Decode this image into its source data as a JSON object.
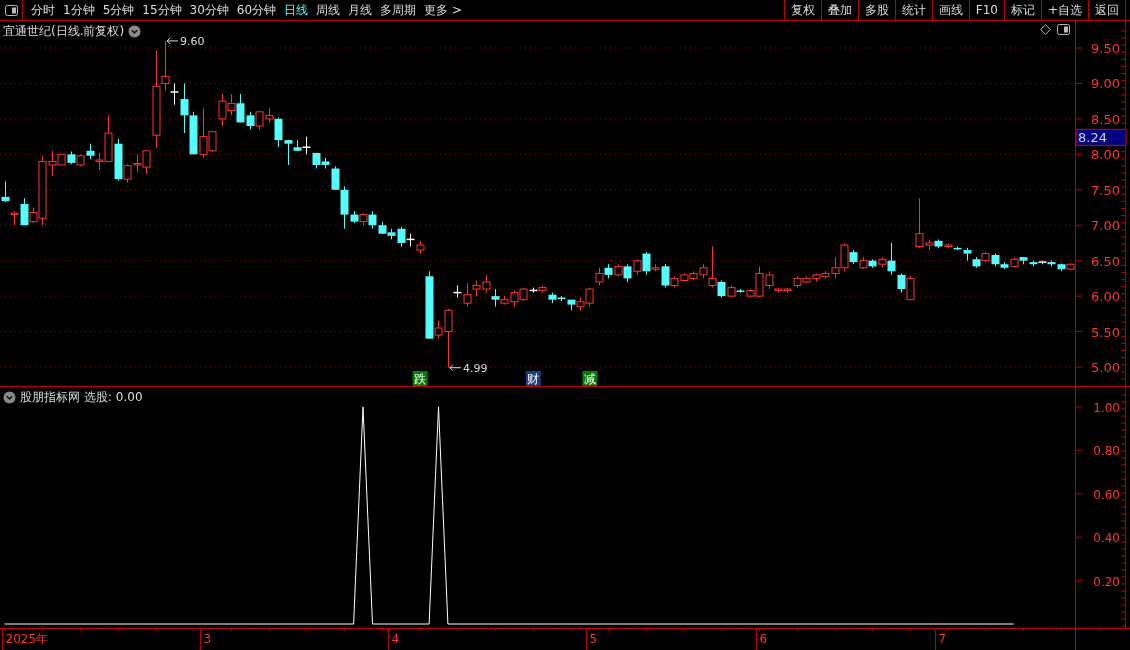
{
  "toolbar": {
    "periods": [
      {
        "label": "分时",
        "selected": false
      },
      {
        "label": "1分钟",
        "selected": false
      },
      {
        "label": "5分钟",
        "selected": false
      },
      {
        "label": "15分钟",
        "selected": false
      },
      {
        "label": "30分钟",
        "selected": false
      },
      {
        "label": "60分钟",
        "selected": false
      },
      {
        "label": "日线",
        "selected": true
      },
      {
        "label": "周线",
        "selected": false
      },
      {
        "label": "月线",
        "selected": false
      },
      {
        "label": "多周期",
        "selected": false
      },
      {
        "label": "更多 >",
        "selected": false
      }
    ],
    "actions": [
      "复权",
      "叠加",
      "多股",
      "统计",
      "画线",
      "F10",
      "标记",
      "+自选",
      "返回"
    ]
  },
  "price_panel": {
    "title": "宜通世纪(日线.前复权)",
    "cursor_price": "8.24",
    "chart_data": {
      "type": "candlestick",
      "ylim": [
        4.718,
        9.881
      ],
      "grid": true,
      "categories": [
        null,
        null,
        null,
        null,
        null,
        null,
        null,
        null,
        null,
        null,
        null,
        null,
        null,
        null,
        null,
        null,
        null,
        null,
        null,
        null,
        null,
        null,
        null,
        null,
        null,
        null,
        null,
        null,
        null,
        null,
        null,
        null,
        null,
        null,
        null,
        null,
        null,
        null,
        null,
        null,
        null,
        null,
        null,
        null,
        null,
        null,
        null,
        null,
        null,
        null,
        null,
        null,
        null,
        null,
        null,
        null,
        null,
        null,
        null,
        null,
        null,
        null,
        null,
        null,
        null,
        null,
        null,
        null,
        null,
        null,
        null,
        null,
        null,
        null,
        null,
        null,
        null,
        null,
        null,
        null,
        null,
        null,
        null,
        null,
        null,
        null,
        null,
        null,
        null,
        null,
        null,
        null,
        null,
        null,
        null,
        null,
        null,
        null,
        null,
        null,
        null,
        null,
        null,
        null,
        null,
        null,
        null,
        null,
        null,
        null,
        null,
        null,
        null,
        null
      ],
      "yticks": [
        {
          "value": 9.5,
          "label": "9.50"
        },
        {
          "value": 9,
          "label": "9.00"
        },
        {
          "value": 8.5,
          "label": "8.50"
        },
        {
          "value": 8,
          "label": "8.00"
        },
        {
          "value": 7.5,
          "label": "7.50"
        },
        {
          "value": 7,
          "label": "7.00"
        },
        {
          "value": 6.5,
          "label": "6.50"
        },
        {
          "value": 6,
          "label": "6.00"
        },
        {
          "value": 5.5,
          "label": "5.50"
        },
        {
          "value": 5,
          "label": "5.00"
        }
      ],
      "ohlc": [
        [
          7.4,
          7.62,
          7.33,
          7.34
        ],
        [
          7.15,
          7.2,
          7.0,
          7.17
        ],
        [
          7.3,
          7.38,
          7.0,
          7.0
        ],
        [
          7.05,
          7.25,
          7.03,
          7.18
        ],
        [
          7.1,
          7.98,
          7.0,
          7.9
        ],
        [
          7.85,
          8.05,
          7.7,
          7.9
        ],
        [
          7.85,
          8.0,
          7.85,
          8.0
        ],
        [
          8.0,
          8.04,
          7.86,
          7.88
        ],
        [
          7.85,
          8.0,
          7.83,
          7.98
        ],
        [
          8.05,
          8.15,
          7.93,
          7.98
        ],
        [
          7.9,
          8.02,
          7.78,
          7.92
        ],
        [
          7.9,
          8.55,
          7.9,
          8.3
        ],
        [
          8.15,
          8.22,
          7.63,
          7.65
        ],
        [
          7.65,
          7.86,
          7.6,
          7.84
        ],
        [
          7.85,
          8.0,
          7.75,
          7.87
        ],
        [
          7.82,
          8.05,
          7.72,
          8.05
        ],
        [
          8.27,
          9.46,
          8.09,
          8.96
        ],
        [
          9.0,
          9.6,
          8.9,
          9.1
        ],
        [
          8.88,
          9.0,
          8.7,
          8.88
        ],
        [
          8.78,
          9.0,
          8.3,
          8.55
        ],
        [
          8.55,
          8.6,
          8.0,
          8.0
        ],
        [
          8.0,
          8.65,
          7.95,
          8.25
        ],
        [
          8.05,
          8.33,
          8.03,
          8.32
        ],
        [
          8.5,
          8.85,
          8.4,
          8.75
        ],
        [
          8.62,
          8.85,
          8.55,
          8.72
        ],
        [
          8.72,
          8.85,
          8.45,
          8.45
        ],
        [
          8.55,
          8.6,
          8.35,
          8.4
        ],
        [
          8.4,
          8.6,
          8.35,
          8.6
        ],
        [
          8.5,
          8.65,
          8.45,
          8.55
        ],
        [
          8.5,
          8.52,
          8.1,
          8.2
        ],
        [
          8.2,
          8.2,
          7.85,
          8.15
        ],
        [
          8.1,
          8.2,
          8.05,
          8.05
        ],
        [
          8.1,
          8.25,
          8.0,
          8.1
        ],
        [
          8.02,
          8.02,
          7.8,
          7.85
        ],
        [
          7.9,
          7.95,
          7.8,
          7.85
        ],
        [
          7.8,
          7.83,
          7.5,
          7.5
        ],
        [
          7.5,
          7.55,
          6.95,
          7.15
        ],
        [
          7.15,
          7.2,
          7.03,
          7.05
        ],
        [
          7.05,
          7.17,
          7.0,
          7.15
        ],
        [
          7.15,
          7.2,
          6.95,
          7.0
        ],
        [
          7.0,
          7.05,
          6.88,
          6.88
        ],
        [
          6.9,
          6.95,
          6.8,
          6.85
        ],
        [
          6.95,
          6.98,
          6.7,
          6.75
        ],
        [
          6.8,
          6.88,
          6.7,
          6.8
        ],
        [
          6.65,
          6.78,
          6.6,
          6.72
        ],
        [
          6.28,
          6.35,
          5.4,
          5.4
        ],
        [
          5.45,
          5.65,
          5.4,
          5.55
        ],
        [
          5.5,
          5.82,
          4.99,
          5.8
        ],
        [
          6.05,
          6.15,
          5.98,
          6.05
        ],
        [
          5.9,
          6.18,
          5.85,
          6.02
        ],
        [
          6.1,
          6.22,
          6.0,
          6.15
        ],
        [
          6.1,
          6.3,
          6.05,
          6.2
        ],
        [
          6.0,
          6.1,
          5.85,
          5.95
        ],
        [
          5.9,
          6.0,
          5.88,
          5.95
        ],
        [
          5.92,
          6.08,
          5.85,
          6.05
        ],
        [
          5.95,
          6.12,
          5.93,
          6.1
        ],
        [
          6.08,
          6.12,
          6.05,
          6.08
        ],
        [
          6.08,
          6.15,
          6.05,
          6.12
        ],
        [
          6.02,
          6.05,
          5.9,
          5.95
        ],
        [
          5.98,
          6.0,
          5.93,
          5.97
        ],
        [
          5.95,
          5.95,
          5.8,
          5.88
        ],
        [
          5.85,
          5.98,
          5.8,
          5.92
        ],
        [
          5.9,
          6.12,
          5.85,
          6.1
        ],
        [
          6.2,
          6.4,
          6.15,
          6.32
        ],
        [
          6.4,
          6.45,
          6.25,
          6.3
        ],
        [
          6.3,
          6.45,
          6.28,
          6.42
        ],
        [
          6.42,
          6.45,
          6.2,
          6.25
        ],
        [
          6.35,
          6.52,
          6.3,
          6.5
        ],
        [
          6.6,
          6.62,
          6.3,
          6.35
        ],
        [
          6.38,
          6.45,
          6.35,
          6.4
        ],
        [
          6.42,
          6.45,
          6.12,
          6.15
        ],
        [
          6.15,
          6.28,
          6.12,
          6.25
        ],
        [
          6.22,
          6.32,
          6.2,
          6.3
        ],
        [
          6.25,
          6.35,
          6.22,
          6.32
        ],
        [
          6.3,
          6.45,
          6.25,
          6.4
        ],
        [
          6.15,
          6.7,
          6.12,
          6.25
        ],
        [
          6.2,
          6.22,
          5.98,
          6.0
        ],
        [
          6.0,
          6.15,
          5.98,
          6.12
        ],
        [
          6.08,
          6.1,
          6.05,
          6.07
        ],
        [
          6.0,
          6.1,
          5.98,
          6.08
        ],
        [
          6.0,
          6.42,
          5.98,
          6.32
        ],
        [
          6.15,
          6.35,
          6.1,
          6.3
        ],
        [
          6.08,
          6.12,
          6.05,
          6.1
        ],
        [
          6.08,
          6.12,
          6.05,
          6.1
        ],
        [
          6.15,
          6.28,
          6.12,
          6.25
        ],
        [
          6.2,
          6.28,
          6.18,
          6.25
        ],
        [
          6.25,
          6.32,
          6.2,
          6.3
        ],
        [
          6.28,
          6.35,
          6.25,
          6.32
        ],
        [
          6.32,
          6.55,
          6.25,
          6.4
        ],
        [
          6.4,
          6.75,
          6.35,
          6.72
        ],
        [
          6.62,
          6.65,
          6.45,
          6.48
        ],
        [
          6.4,
          6.55,
          6.38,
          6.5
        ],
        [
          6.5,
          6.52,
          6.4,
          6.42
        ],
        [
          6.45,
          6.55,
          6.4,
          6.52
        ],
        [
          6.5,
          6.75,
          6.3,
          6.35
        ],
        [
          6.3,
          6.32,
          6.05,
          6.1
        ],
        [
          5.95,
          6.28,
          5.95,
          6.25
        ],
        [
          6.7,
          7.38,
          6.68,
          6.88
        ],
        [
          6.72,
          6.8,
          6.65,
          6.75
        ],
        [
          6.78,
          6.8,
          6.68,
          6.7
        ],
        [
          6.7,
          6.74,
          6.68,
          6.72
        ],
        [
          6.68,
          6.7,
          6.65,
          6.67
        ],
        [
          6.65,
          6.68,
          6.5,
          6.6
        ],
        [
          6.52,
          6.55,
          6.4,
          6.42
        ],
        [
          6.5,
          6.62,
          6.48,
          6.6
        ],
        [
          6.58,
          6.6,
          6.42,
          6.45
        ],
        [
          6.45,
          6.48,
          6.38,
          6.4
        ],
        [
          6.42,
          6.55,
          6.4,
          6.52
        ],
        [
          6.55,
          6.55,
          6.45,
          6.5
        ],
        [
          6.48,
          6.5,
          6.42,
          6.45
        ],
        [
          6.48,
          6.5,
          6.45,
          6.48
        ],
        [
          6.48,
          6.5,
          6.42,
          6.45
        ],
        [
          6.45,
          6.46,
          6.35,
          6.38
        ],
        [
          6.38,
          6.46,
          6.36,
          6.45
        ]
      ],
      "annotations": [
        "9.60",
        "4.99"
      ]
    },
    "event_markers": [
      {
        "label": "跌",
        "color": "#0a7a0a"
      },
      {
        "label": "财",
        "color": "#1c3c80"
      },
      {
        "label": "减",
        "color": "#0a7a0a"
      }
    ]
  },
  "indicator_panel": {
    "title": "股朋指标网",
    "reading": "选股: 0.00",
    "chart_data": {
      "type": "line",
      "ylim": [
        -0.0183,
        1.0917
      ],
      "categories": [
        null,
        null,
        null,
        null,
        null,
        null,
        null,
        null,
        null,
        null,
        null,
        null,
        null,
        null,
        null,
        null,
        null,
        null,
        null,
        null,
        null,
        null,
        null,
        null,
        null,
        null,
        null,
        null,
        null,
        null,
        null,
        null,
        null,
        null,
        null,
        null,
        null,
        null,
        null,
        null,
        null,
        null,
        null,
        null,
        null,
        null,
        null,
        null,
        null,
        null,
        null,
        null,
        null,
        null,
        null,
        null,
        null,
        null,
        null,
        null,
        null,
        null,
        null,
        null,
        null,
        null,
        null,
        null,
        null,
        null,
        null,
        null,
        null,
        null,
        null,
        null,
        null,
        null,
        null,
        null,
        null,
        null,
        null,
        null,
        null,
        null,
        null,
        null,
        null,
        null,
        null,
        null,
        null,
        null,
        null,
        null,
        null,
        null,
        null,
        null,
        null,
        null,
        null,
        null,
        null,
        null,
        null,
        null,
        null,
        null,
        null,
        null,
        null,
        null
      ],
      "yticks": [
        {
          "value": 1,
          "label": "1.00"
        },
        {
          "value": 0.8,
          "label": "0.80"
        },
        {
          "value": 0.6,
          "label": "0.60"
        },
        {
          "value": 0.4,
          "label": "0.40"
        },
        {
          "value": 0.2,
          "label": "0.20"
        }
      ],
      "series": [
        {
          "color": "#ffffff",
          "values": [
            0,
            0,
            0,
            0,
            0,
            0,
            0,
            0,
            0,
            0,
            0,
            0,
            0,
            0,
            0,
            0,
            0,
            0,
            0,
            0,
            0,
            0,
            0,
            0,
            0,
            0,
            0,
            0,
            0,
            0,
            0,
            0,
            0,
            0,
            0,
            0,
            0,
            0,
            1,
            0,
            0,
            0,
            0,
            0,
            0,
            0,
            1,
            0,
            0,
            0,
            0,
            0,
            0,
            0,
            0,
            0,
            0,
            0,
            0,
            0,
            0,
            0,
            0,
            0,
            0,
            0,
            0,
            0,
            0,
            0,
            0,
            0,
            0,
            0,
            0,
            0,
            0,
            0,
            0,
            0,
            0,
            0,
            0,
            0,
            0,
            0,
            0,
            0,
            0,
            0,
            0,
            0,
            0,
            0,
            0,
            0,
            0,
            0,
            0,
            0,
            0,
            0,
            0,
            0,
            0,
            0,
            0,
            0,
            null,
            null,
            null,
            null,
            null,
            null
          ]
        }
      ]
    },
    "time_axis": [
      "2025年",
      "3",
      "4",
      "5",
      "6",
      "7"
    ]
  }
}
